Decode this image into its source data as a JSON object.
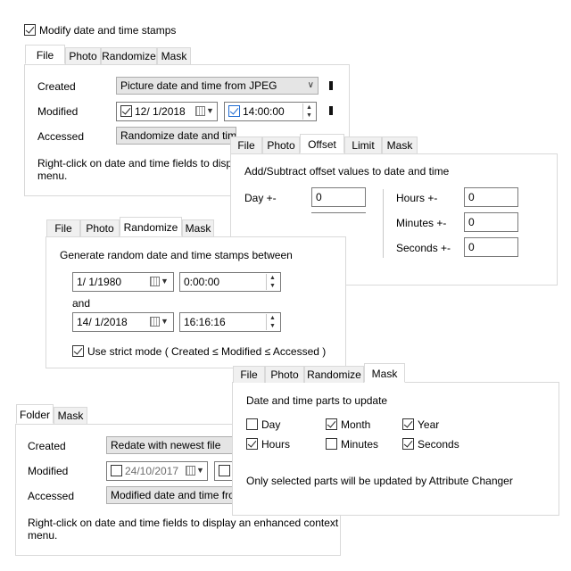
{
  "top_checkbox": {
    "label": "Modify date and time stamps",
    "checked": true
  },
  "file_panel": {
    "tabs": [
      "File",
      "Photo",
      "Randomize",
      "Mask"
    ],
    "active_tab": "File",
    "created_label": "Created",
    "created_value": "Picture date and time from JPEG",
    "modified_label": "Modified",
    "modified_date": "12/ 1/2018",
    "modified_time": "14:00:00",
    "accessed_label": "Accessed",
    "accessed_value": "Randomize date and time",
    "hint_line1": "Right-click on date and time fields to display a",
    "hint_line2": "menu."
  },
  "offset_panel": {
    "tabs": [
      "File",
      "Photo",
      "Offset",
      "Limit",
      "Mask"
    ],
    "active_tab": "Offset",
    "description": "Add/Subtract offset values to date and time",
    "day_label": "Day +-",
    "day_value": "0",
    "hours_label": "Hours +-",
    "hours_value": "0",
    "minutes_label": "Minutes +-",
    "minutes_value": "0",
    "seconds_label": "Seconds +-",
    "seconds_value": "0"
  },
  "randomize_panel": {
    "tabs": [
      "File",
      "Photo",
      "Randomize",
      "Mask"
    ],
    "active_tab": "Randomize",
    "description": "Generate random date and time stamps between",
    "start_date": "1/ 1/1980",
    "start_time": "0:00:00",
    "and_label": "and",
    "end_date": "14/ 1/2018",
    "end_time": "16:16:16",
    "strict_label": "Use strict mode ( Created ≤ Modified ≤ Accessed )",
    "strict_checked": true
  },
  "mask_panel": {
    "tabs": [
      "File",
      "Photo",
      "Randomize",
      "Mask"
    ],
    "active_tab": "Mask",
    "description": "Date and time parts to update",
    "parts": [
      {
        "label": "Day",
        "checked": false
      },
      {
        "label": "Month",
        "checked": true
      },
      {
        "label": "Year",
        "checked": true
      },
      {
        "label": "Hours",
        "checked": true
      },
      {
        "label": "Minutes",
        "checked": false
      },
      {
        "label": "Seconds",
        "checked": true
      }
    ],
    "note": "Only selected parts will be updated by Attribute Changer"
  },
  "folder_panel": {
    "tabs": [
      "Folder",
      "Mask"
    ],
    "active_tab": "Folder",
    "created_label": "Created",
    "created_value": "Redate with newest file",
    "modified_label": "Modified",
    "modified_date": "24/10/2017",
    "accessed_label": "Accessed",
    "accessed_value": "Modified date and time from",
    "hint_line1": "Right-click on date and time fields to display an enhanced context",
    "hint_line2": "menu."
  }
}
